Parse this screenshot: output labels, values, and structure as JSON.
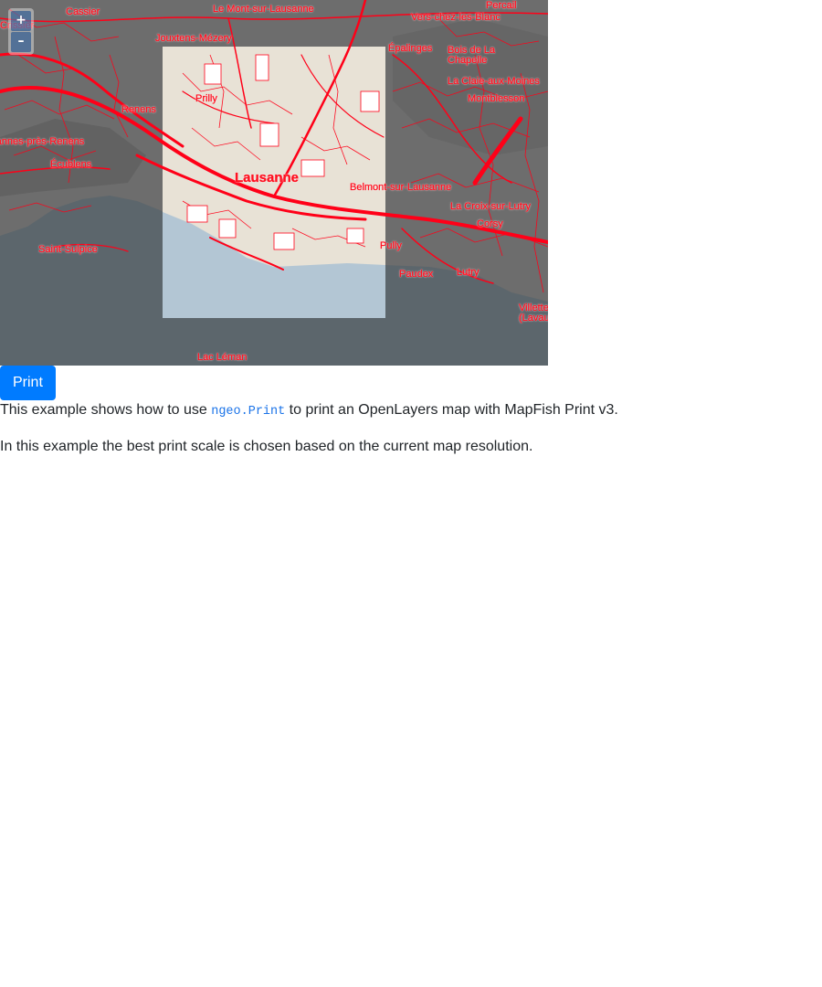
{
  "map": {
    "labels": [
      "Cassier",
      "Le Mont-sur-Lausanne",
      "Percail",
      "Vers-chez-les-Blanc",
      "Jouxtens-Mézery",
      "Épalinges",
      "Bois de La Chapelle",
      "La Claie-aux-Moines",
      "Montblesson",
      "Renens",
      "Prilly",
      "Crissier",
      "Chavannes-près-Renens",
      "Écublens",
      "Lausanne",
      "Belmont-sur-Lausanne",
      "La Croix-sur-Lutry",
      "Corsy",
      "Saint-Sulpice",
      "Pully",
      "Paudex",
      "Lutry",
      "Villette (Lavaux)",
      "Lac Léman"
    ],
    "colors": {
      "lake": "#5c666c",
      "land": "#6b6b6b",
      "roads": "#ff0018",
      "print_area": "#e8e2d6",
      "print_lake": "#b3c6d4"
    }
  },
  "zoom": {
    "in_label": "+",
    "out_label": "–"
  },
  "print_button": {
    "label": "Print"
  },
  "description": {
    "line1_before": "This example shows how to use ",
    "line1_code": "ngeo.Print",
    "line1_after": " to print an OpenLayers map with MapFish Print v3.",
    "line2": "In this example the best print scale is chosen based on the current map resolution."
  }
}
